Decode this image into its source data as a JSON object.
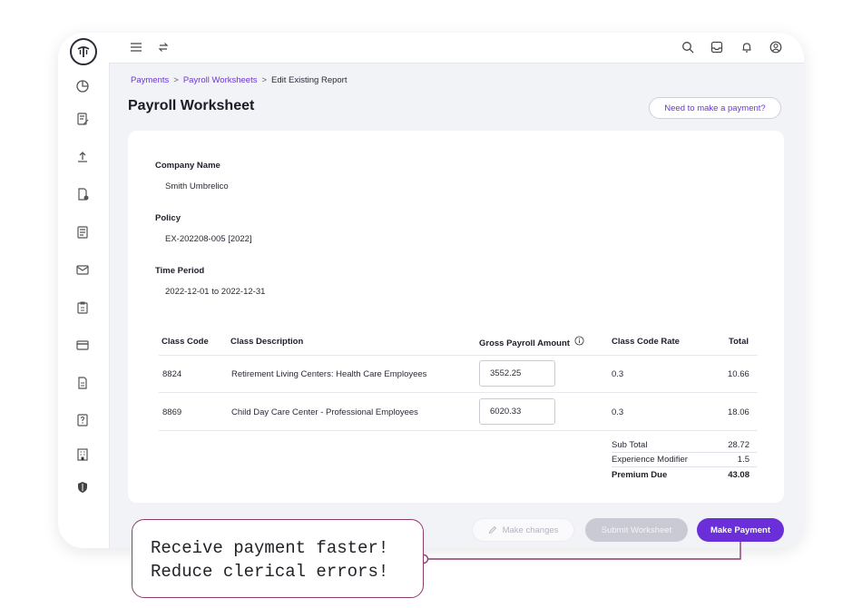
{
  "breadcrumb": {
    "items": [
      "Payments",
      "Payroll Worksheets"
    ],
    "current": "Edit Existing Report",
    "separator": ">"
  },
  "page": {
    "title": "Payroll Worksheet",
    "help_button": "Need to make a payment?"
  },
  "fields": {
    "company_label": "Company Name",
    "company_value": "Smith Umbrelico",
    "policy_label": "Policy",
    "policy_value": "EX-202208-005 [2022]",
    "period_label": "Time Period",
    "period_value": "2022-12-01 to 2022-12-31"
  },
  "table": {
    "headers": {
      "code": "Class Code",
      "description": "Class Description",
      "gross": "Gross Payroll Amount",
      "rate": "Class Code Rate",
      "total": "Total"
    },
    "rows": [
      {
        "code": "8824",
        "description": "Retirement Living Centers: Health Care Employees",
        "gross": "3552.25",
        "rate": "0.3",
        "total": "10.66"
      },
      {
        "code": "8869",
        "description": "Child Day Care Center - Professional Employees",
        "gross": "6020.33",
        "rate": "0.3",
        "total": "18.06"
      }
    ]
  },
  "summary": {
    "subtotal_label": "Sub Total",
    "subtotal_value": "28.72",
    "modifier_label": "Experience Modifier",
    "modifier_value": "1.5",
    "premium_label": "Premium Due",
    "premium_value": "43.08"
  },
  "actions": {
    "make_changes": "Make changes",
    "submit": "Submit Worksheet",
    "make_payment": "Make Payment"
  },
  "callout": {
    "line1": "Receive payment faster!",
    "line2": "Reduce clerical errors!"
  },
  "icons": {
    "sidebar": [
      "pie-chart-icon",
      "document-edit-icon",
      "upload-icon",
      "document-shield-icon",
      "document-list-icon",
      "mail-icon",
      "clipboard-icon",
      "credit-card-icon",
      "file-icon",
      "help-icon",
      "building-icon",
      "shield-icon"
    ],
    "topbar": [
      "menu-icon",
      "swap-icon",
      "search-icon",
      "inbox-icon",
      "bell-icon",
      "user-icon"
    ]
  },
  "colors": {
    "accent": "#6a2fd8",
    "callout_border": "#8c3b6e",
    "disabled": "#c9cad3"
  }
}
